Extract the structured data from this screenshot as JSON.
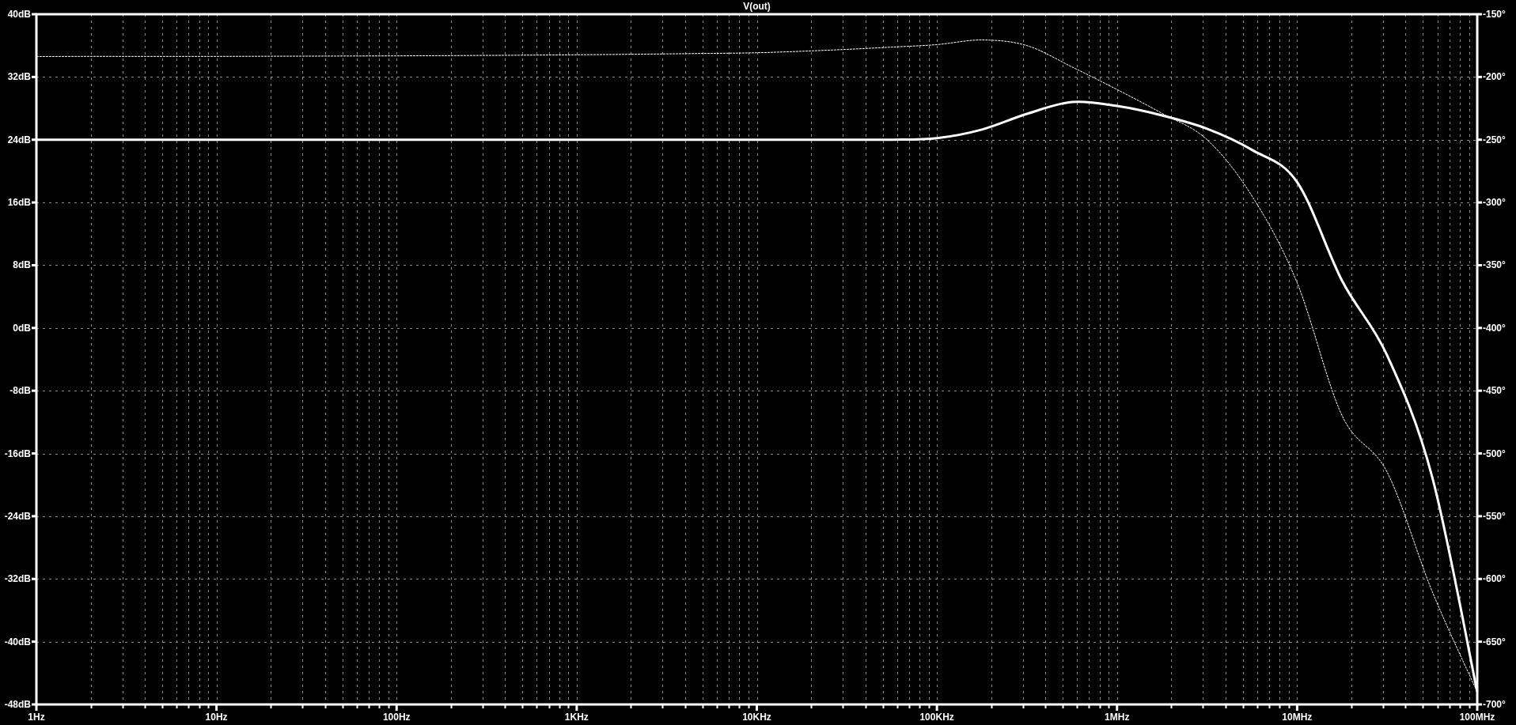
{
  "chart_data": {
    "type": "line",
    "title": "V(out)",
    "grid": true,
    "categories": [
      "1Hz",
      null,
      null,
      null,
      "10Hz",
      null,
      null,
      null,
      "100Hz",
      null,
      null,
      null,
      "1KHz",
      null,
      null,
      null,
      "10KHz",
      null,
      null,
      null,
      "100KHz",
      null,
      null,
      null,
      "1MHz",
      null,
      null,
      null,
      "10MHz",
      null,
      null,
      null,
      "100MHz"
    ],
    "series": [
      {
        "color": "#ffffff",
        "line_style": "solid",
        "values": [
          24,
          24,
          24,
          24,
          24,
          24,
          24,
          24,
          24,
          24,
          24,
          24,
          24,
          24,
          24,
          24,
          24,
          24,
          24,
          24,
          24.2,
          25.3,
          27.3,
          28.8,
          28.3,
          27.1,
          25.4,
          22.7,
          18.6,
          6,
          -3.5,
          -19,
          -46.4
        ]
      }
    ],
    "ylim": [
      -48,
      40
    ],
    "yticks": [
      {
        "value": 40,
        "label": "40dB"
      },
      {
        "value": 32,
        "label": "32dB"
      },
      {
        "value": 24,
        "label": "24dB"
      },
      {
        "value": 16,
        "label": "16dB"
      },
      {
        "value": 8,
        "label": "8dB"
      },
      {
        "value": 0,
        "label": "0dB"
      },
      {
        "value": -8,
        "label": "-8dB"
      },
      {
        "value": -16,
        "label": "-16dB"
      },
      {
        "value": -24,
        "label": "-24dB"
      },
      {
        "value": -32,
        "label": "-32dB"
      },
      {
        "value": -40,
        "label": "-40dB"
      },
      {
        "value": -48,
        "label": "-48dB"
      }
    ]
  },
  "phase": {
    "chart_data": {
      "type": "line",
      "categories": [
        null,
        null,
        null,
        null,
        null,
        null,
        null,
        null,
        null,
        null,
        null,
        null,
        null,
        null,
        null,
        null,
        null,
        null,
        null,
        null,
        null,
        null,
        null,
        null,
        null,
        null,
        null,
        null,
        null,
        null,
        null,
        null,
        null
      ],
      "series": [
        {
          "color": "#ffffff",
          "line_style": "dashed",
          "values": [
            -183.7,
            -183.6,
            -183.6,
            -183.6,
            -183.6,
            -183.5,
            -183.4,
            -183.3,
            -183.2,
            -183,
            -182.8,
            -182.6,
            -182.3,
            -182,
            -181.6,
            -181.2,
            -180.7,
            -179.5,
            -178,
            -176.2,
            -174.2,
            -170.5,
            -175,
            -192,
            -210,
            -229,
            -250,
            -295,
            -364,
            -470,
            -515,
            -610,
            -690
          ]
        }
      ],
      "ylim": [
        -700,
        -150
      ],
      "yticks": [
        {
          "value": -150,
          "label": "-150°"
        },
        {
          "value": -200,
          "label": "-200°"
        },
        {
          "value": -250,
          "label": "-250°"
        },
        {
          "value": -300,
          "label": "-300°"
        },
        {
          "value": -350,
          "label": "-350°"
        },
        {
          "value": -400,
          "label": "-400°"
        },
        {
          "value": -450,
          "label": "-450°"
        },
        {
          "value": -500,
          "label": "-500°"
        },
        {
          "value": -550,
          "label": "-550°"
        },
        {
          "value": -600,
          "label": "-600°"
        },
        {
          "value": -650,
          "label": "-650°"
        },
        {
          "value": -700,
          "label": "-700°"
        }
      ]
    }
  }
}
